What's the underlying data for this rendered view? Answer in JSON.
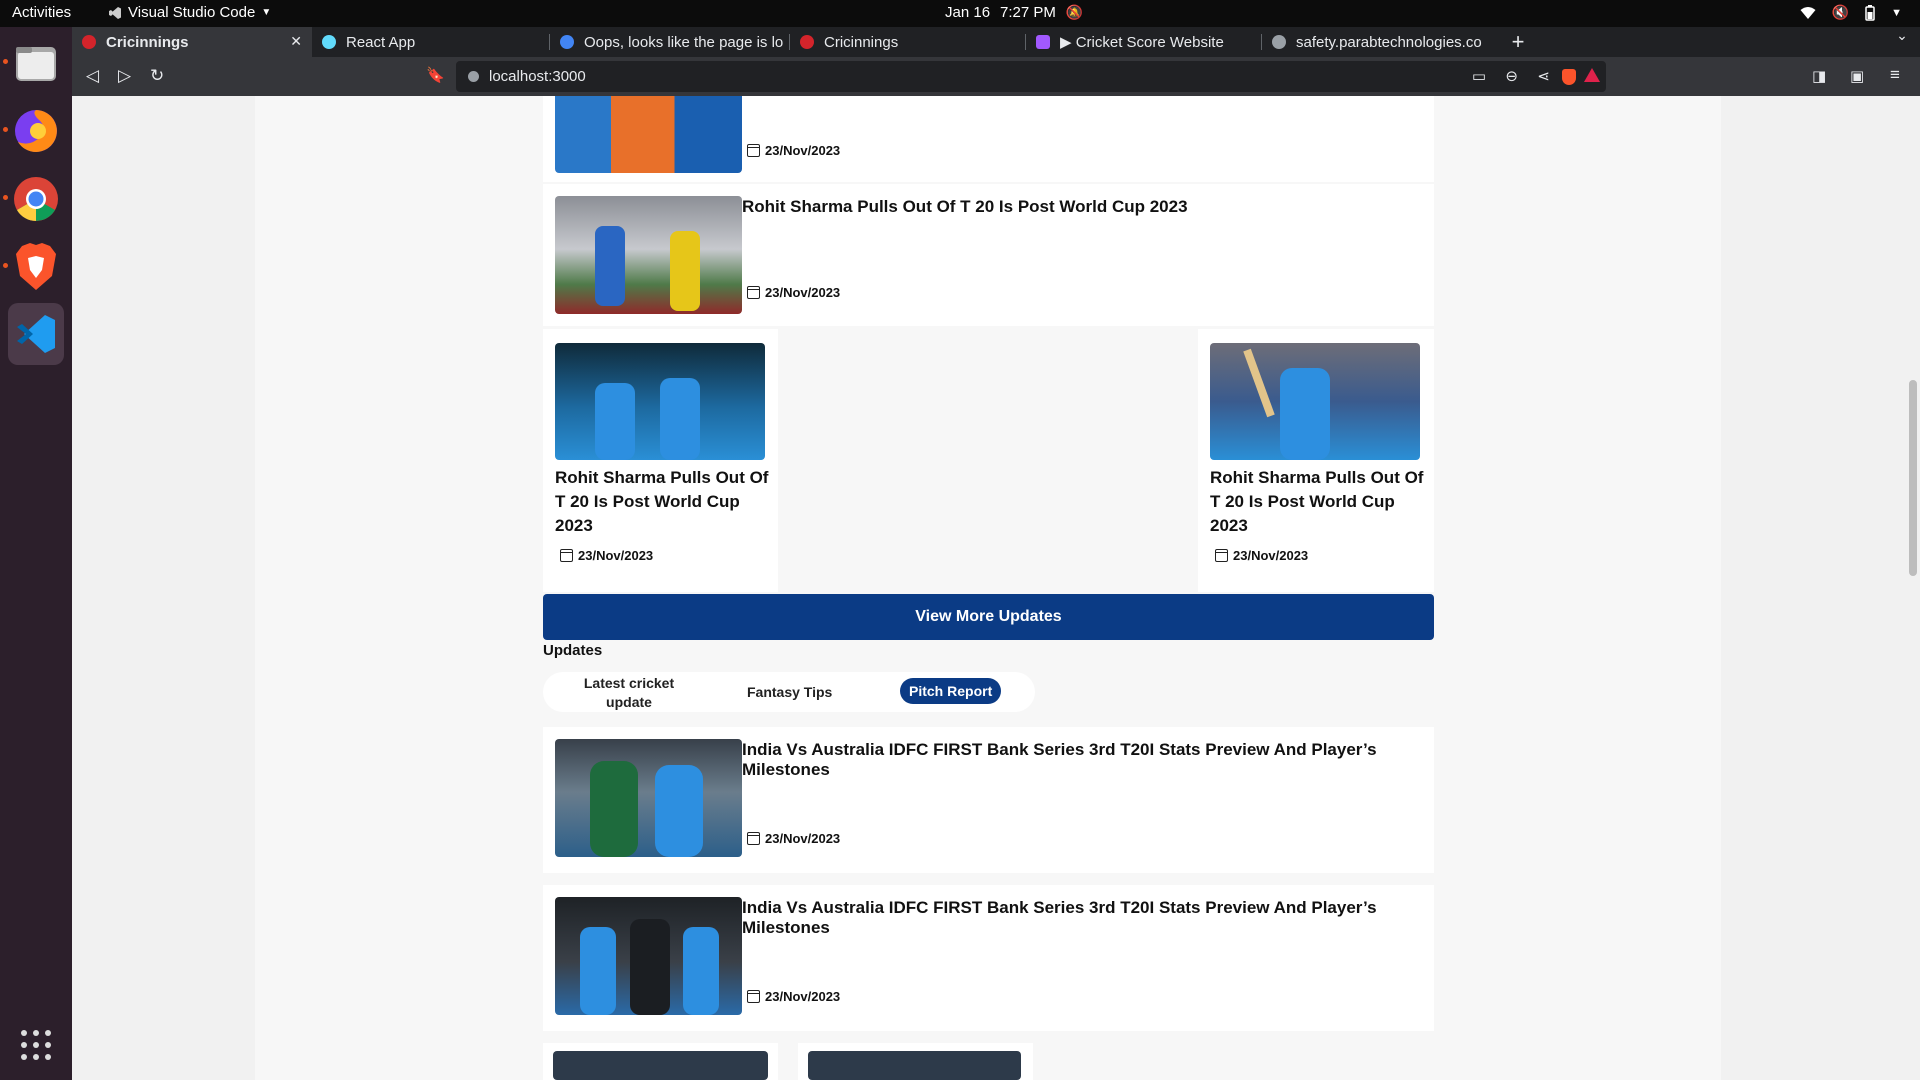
{
  "topbar": {
    "activities": "Activities",
    "app": "Visual Studio Code",
    "date": "Jan 16",
    "time": "7:27 PM"
  },
  "browser": {
    "tabs": [
      {
        "label": "Cricinnings",
        "favicon_color": "#d4242b"
      },
      {
        "label": "React App",
        "favicon_color": "#61dafb"
      },
      {
        "label": "Oops, looks like the page is lo",
        "favicon_color": "#4285f4"
      },
      {
        "label": "Cricinnings",
        "favicon_color": "#d4242b"
      },
      {
        "label": "▶ Cricket Score Website",
        "favicon_color": "#a259ff"
      },
      {
        "label": "safety.parabtechnologies.co",
        "favicon_color": "#9aa0a6"
      }
    ],
    "url": "localhost:3000"
  },
  "page": {
    "news_items_top": [
      {
        "title": "",
        "date": "23/Nov/2023"
      },
      {
        "title": "Rohit Sharma Pulls Out Of T 20 Is Post World Cup 2023",
        "date": "23/Nov/2023"
      }
    ],
    "grid_cards": [
      {
        "title": "Rohit Sharma Pulls Out Of T 20 Is Post World Cup 2023",
        "date": "23/Nov/2023"
      },
      {
        "title": "Rohit Sharma Pulls Out Of T 20 Is Post World Cup 2023",
        "date": "23/Nov/2023"
      }
    ],
    "view_more_label": "View More Updates",
    "updates_heading": "Updates",
    "update_tabs": [
      {
        "label": "Latest cricket update"
      },
      {
        "label": "Fantasy Tips"
      },
      {
        "label": "Pitch Report",
        "active": true
      }
    ],
    "update_items": [
      {
        "title": "India Vs Australia IDFC FIRST Bank Series 3rd T20I Stats Preview And Player’s Milestones",
        "date": "23/Nov/2023"
      },
      {
        "title": "India Vs Australia IDFC FIRST Bank Series 3rd T20I Stats Preview And Player’s Milestones",
        "date": "23/Nov/2023"
      }
    ]
  }
}
